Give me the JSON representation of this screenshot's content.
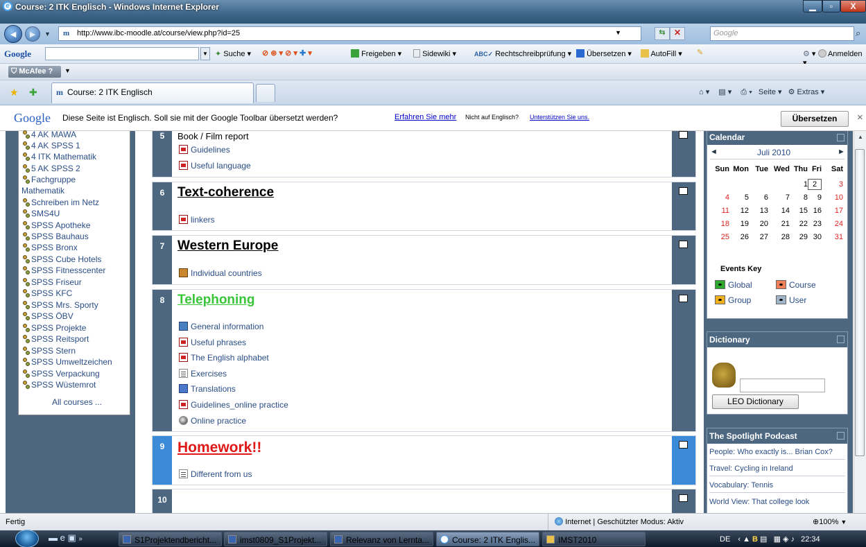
{
  "window": {
    "title": "Course: 2 ITK Englisch - Windows Internet Explorer"
  },
  "address": {
    "url": "http://www.ibc-moodle.at/course/view.php?id=25",
    "search_placeholder": "Google"
  },
  "google_toolbar": {
    "brand": "Google",
    "items": [
      "Suche",
      "Freigeben",
      "Sidewiki",
      "Rechtschreibprüfung",
      "Übersetzen",
      "AutoFill"
    ],
    "signin": "Anmelden"
  },
  "mcafee": {
    "label": "McAfee"
  },
  "tab": {
    "title": "Course: 2 ITK Englisch"
  },
  "command_bar": {
    "page": "Seite",
    "tools": "Extras"
  },
  "translate_bar": {
    "brand": "Google",
    "message": "Diese Seite ist Englisch. Soll sie mit der Google Toolbar übersetzt werden?",
    "learn_more": "Erfahren Sie mehr",
    "not_english": "Nicht auf Englisch?",
    "help_us": "Unterstützen Sie uns.",
    "translate_button": "Übersetzen",
    "close": "×"
  },
  "courses": {
    "items": [
      "4 AK MAWA",
      "4 AK SPSS 1",
      "4 ITK Mathematik",
      "5 AK SPSS 2",
      "Fachgruppe",
      "Mathematik",
      "Schreiben im Netz",
      "SMS4U",
      "SPSS Apotheke",
      "SPSS Bauhaus",
      "SPSS Bronx",
      "SPSS Cube Hotels",
      "SPSS Fitnesscenter",
      "SPSS Friseur",
      "SPSS KFC",
      "SPSS Mrs. Sporty",
      "SPSS ÖBV",
      "SPSS Projekte",
      "SPSS Reitsport",
      "SPSS Stern",
      "SPSS Umweltzeichen",
      "SPSS Verpackung",
      "SPSS Wüstemrot"
    ],
    "all_courses": "All courses ..."
  },
  "sections": {
    "s5": {
      "num": "5",
      "title": "Book / Film report",
      "resources": [
        "Guidelines",
        "Useful language"
      ]
    },
    "s6": {
      "num": "6",
      "title": "Text-coherence",
      "resources": [
        "linkers"
      ]
    },
    "s7": {
      "num": "7",
      "title": "Western Europe",
      "resources": [
        "Individual countries"
      ]
    },
    "s8": {
      "num": "8",
      "title": "Telephoning",
      "resources": [
        "General information",
        "Useful phrases",
        "The English alphabet",
        "Exercises",
        "Translations",
        "Guidelines_online practice",
        "Online practice"
      ]
    },
    "s9": {
      "num": "9",
      "title_main": "Homework",
      "title_suffix": "!!",
      "resources": [
        "Different from us"
      ]
    },
    "s10": {
      "num": "10"
    }
  },
  "calendar": {
    "block_title": "Calendar",
    "month": "Juli 2010",
    "prev": "◄",
    "next": "►",
    "days": [
      "Sun",
      "Mon",
      "Tue",
      "Wed",
      "Thu",
      "Fri",
      "Sat"
    ],
    "weeks": [
      [
        "",
        "",
        "",
        "",
        "1",
        "2",
        "3"
      ],
      [
        "4",
        "5",
        "6",
        "7",
        "8",
        "9",
        "10"
      ],
      [
        "11",
        "12",
        "13",
        "14",
        "15",
        "16",
        "17"
      ],
      [
        "18",
        "19",
        "20",
        "21",
        "22",
        "23",
        "24"
      ],
      [
        "25",
        "26",
        "27",
        "28",
        "29",
        "30",
        "31"
      ]
    ],
    "today": "2",
    "events_key": "Events Key",
    "keys": {
      "global": "Global",
      "course": "Course",
      "group": "Group",
      "user": "User"
    },
    "colors": {
      "global": "#2fa82f",
      "course": "#f08058",
      "group": "#f0b020",
      "user": "#a0b4c8"
    }
  },
  "dictionary": {
    "block_title": "Dictionary",
    "button": "LEO Dictionary"
  },
  "podcast": {
    "block_title": "The Spotlight Podcast",
    "items": [
      "People: Who exactly is... Brian Cox?",
      "Travel: Cycling in Ireland",
      "Vocabulary: Tennis",
      "World View: That college look"
    ]
  },
  "status": {
    "left": "Fertig",
    "zone": "Internet | Geschützter Modus: Aktiv",
    "zoom": "100%"
  },
  "taskbar": {
    "buttons": [
      "S1Projektendbericht...",
      "imst0809_S1Projekt...",
      "Relevanz von Lernta...",
      "Course: 2 ITK Englis...",
      "IMST2010"
    ],
    "lang": "DE",
    "time": "22:34"
  },
  "colors": {
    "section_bar": "#4d6780",
    "current_bar": "#3c8bd8",
    "telephoning": "#3ac43a",
    "homework": "#e01818",
    "link": "#2a4d86"
  }
}
